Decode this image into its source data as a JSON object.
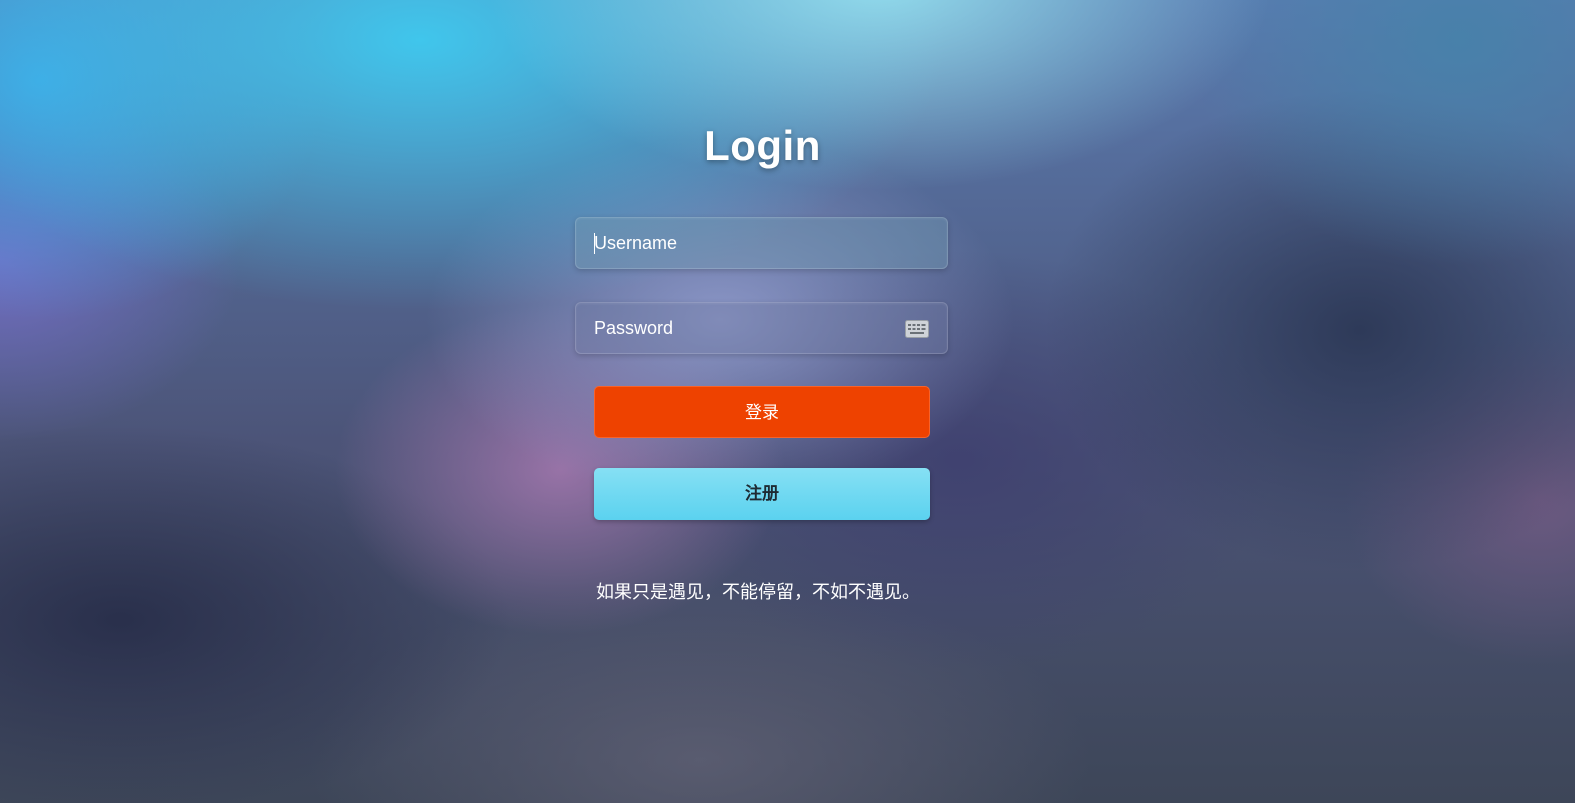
{
  "page": {
    "title": "Login"
  },
  "form": {
    "username_placeholder": "Username",
    "password_placeholder": "Password",
    "keyboard_icon": "keyboard-icon",
    "login_label": "登录",
    "register_label": "注册"
  },
  "footer": {
    "quote": "如果只是遇见，不能停留，不如不遇见。"
  },
  "colors": {
    "login_button": "#ee4200",
    "register_button": "#5bd2ef",
    "text": "#ffffff"
  }
}
